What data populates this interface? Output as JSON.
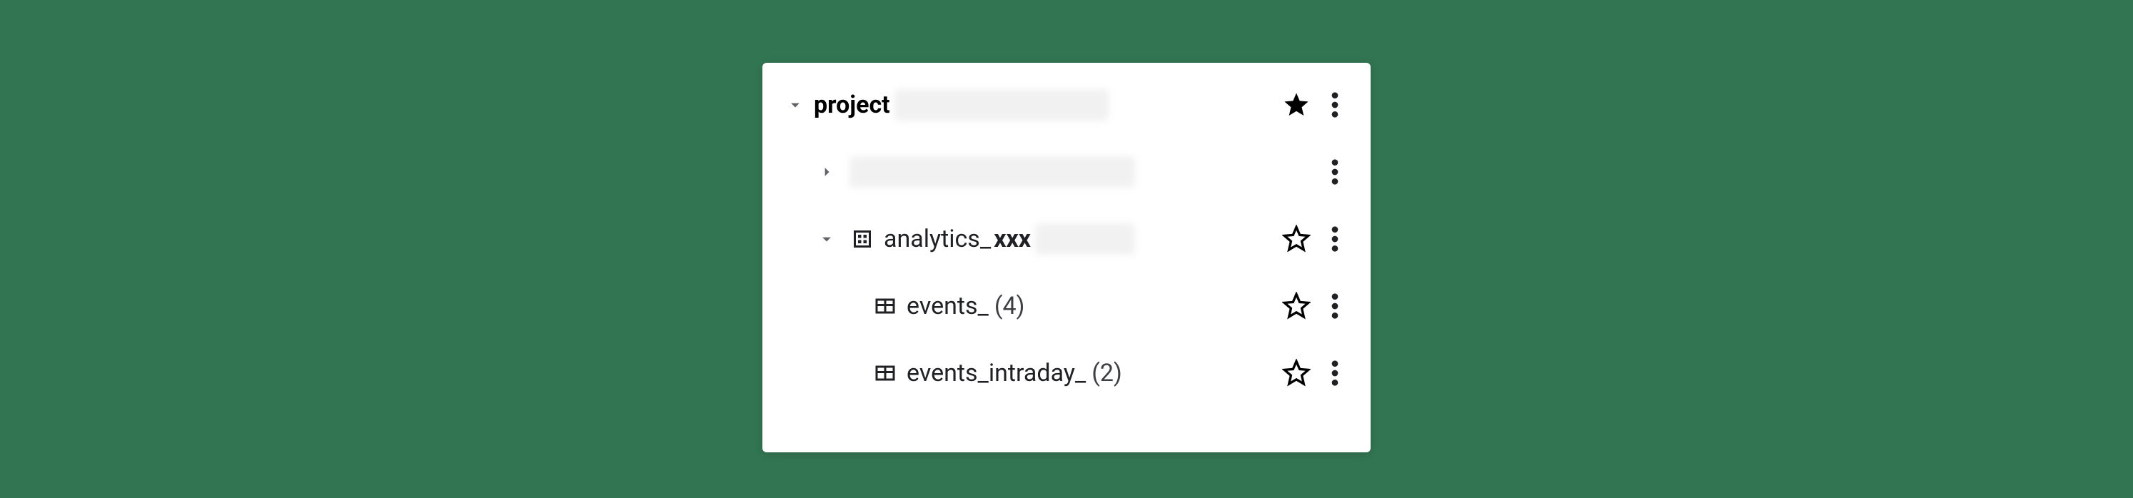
{
  "tree": {
    "project": {
      "label": "project",
      "expanded": true,
      "starred": true
    },
    "dataset_hidden": {
      "expanded": false
    },
    "dataset_analytics": {
      "label_prefix": "analytics_",
      "label_suffix": "xxx",
      "expanded": true,
      "starred": false
    },
    "table_events": {
      "label": "events_",
      "count": "(4)",
      "starred": false
    },
    "table_events_intraday": {
      "label": "events_intraday_",
      "count": "(2)",
      "starred": false
    }
  }
}
